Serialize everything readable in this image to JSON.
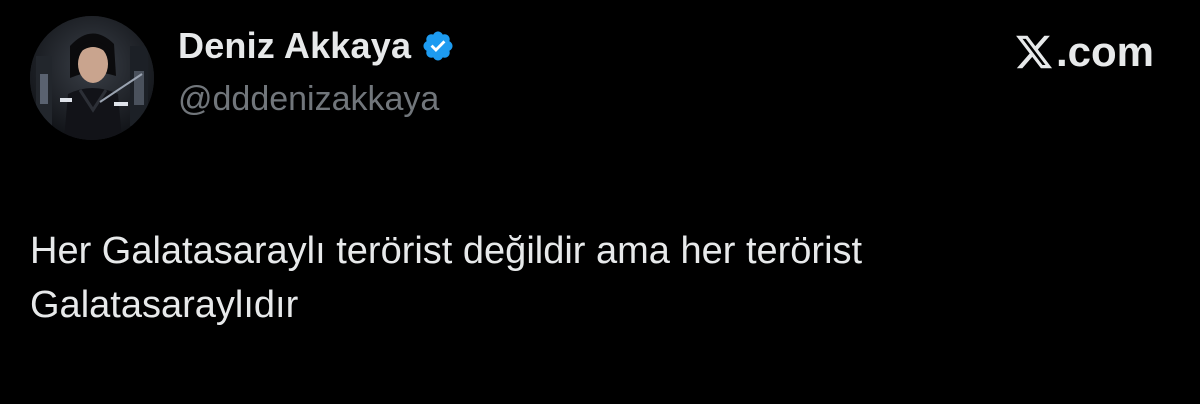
{
  "author": {
    "display_name": "Deniz Akkaya",
    "handle": "@dddenizakkaya",
    "verified": true,
    "verified_color": "#1d9bf0"
  },
  "brand": {
    "text": ".com",
    "logo": "x-logo-icon"
  },
  "tweet": {
    "lines": [
      "Her Galatasaraylı terörist değildir ama her terörist",
      "Galatasaraylıdır"
    ]
  },
  "colors": {
    "background": "#000000",
    "primary_text": "#e7e9ea",
    "secondary_text": "#71767b"
  }
}
